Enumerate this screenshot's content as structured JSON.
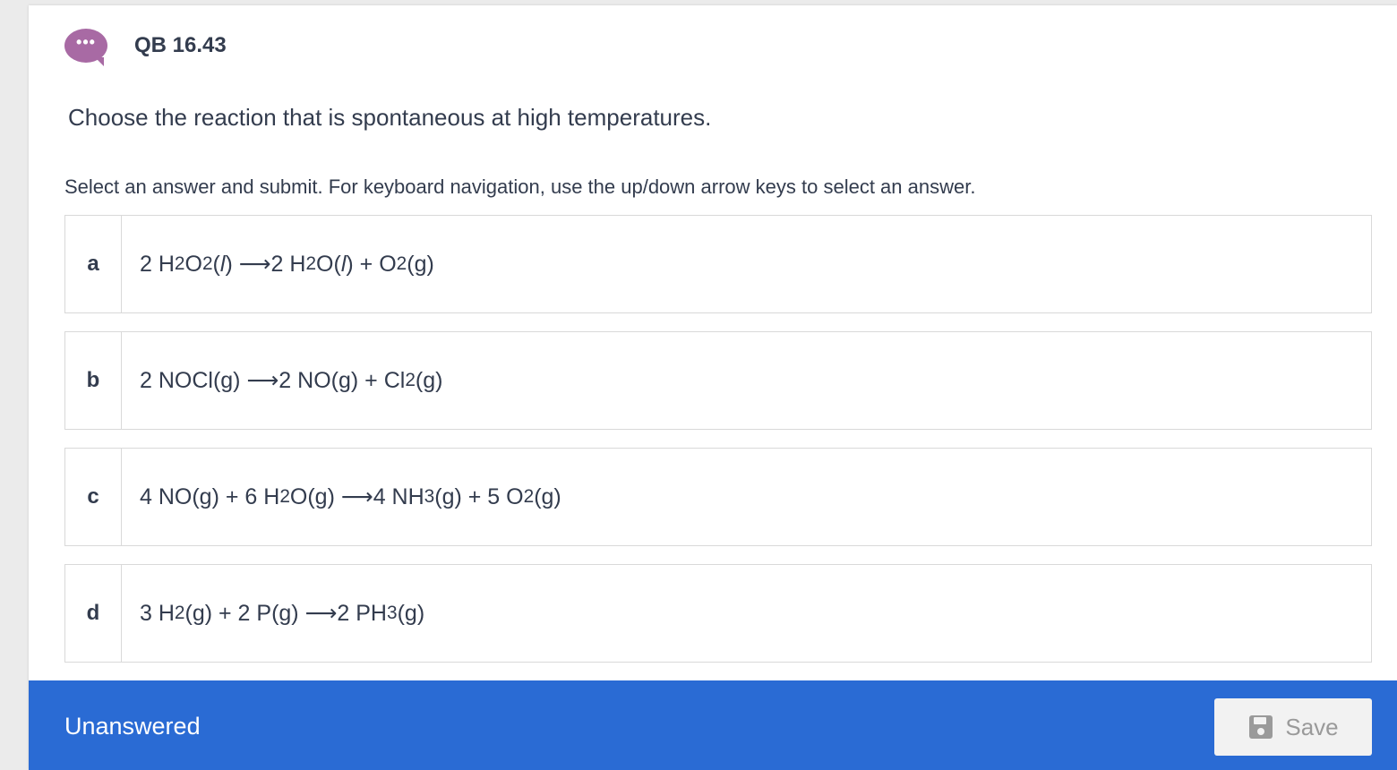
{
  "header": {
    "icon": "chat-bubble-dots-icon",
    "icon_glyph": "•••",
    "question_id": "QB 16.43"
  },
  "question": {
    "text": "Choose the reaction that is spontaneous at high temperatures."
  },
  "instructions": "Select an answer and submit. For keyboard navigation, use the up/down arrow keys to select an answer.",
  "options": [
    {
      "letter": "a",
      "parts": [
        "2 H",
        "2",
        "O",
        "2",
        "(",
        "l",
        ") ⟶2 H",
        "2",
        "O(",
        "l",
        ") + O",
        "2",
        "(g)"
      ],
      "text": "2 H2O2(l) ⟶2 H2O(l) + O2(g)"
    },
    {
      "letter": "b",
      "parts": [
        "2 NOCl(g) ⟶2 NO(g) + Cl",
        "2",
        "(g)"
      ],
      "text": "2 NOCl(g) ⟶2 NO(g) + Cl2(g)"
    },
    {
      "letter": "c",
      "parts": [
        "4 NO(g) + 6 H",
        "2",
        "O(g) ⟶4 NH",
        "3",
        "(g) + 5 O",
        "2",
        "(g)"
      ],
      "text": "4 NO(g) + 6 H2O(g) ⟶4 NH3(g) + 5 O2(g)"
    },
    {
      "letter": "d",
      "parts": [
        "3 H",
        "2",
        "(g) + 2 P(g) ⟶2 PH",
        "3",
        "(g)"
      ],
      "text": "3 H2(g) + 2 P(g) ⟶2 PH3(g)"
    }
  ],
  "footer": {
    "status": "Unanswered",
    "save_label": "Save",
    "save_icon": "floppy-disk-icon"
  },
  "colors": {
    "footer_bg": "#2a6bd4",
    "bubble": "#a86aa4",
    "text": "#333c4e",
    "border": "#d9d9d9"
  }
}
